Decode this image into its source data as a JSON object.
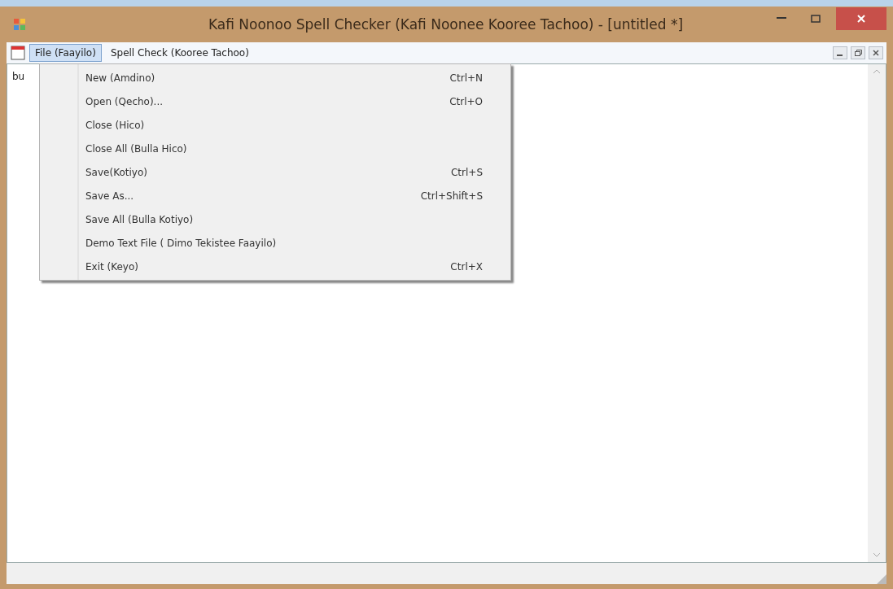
{
  "window": {
    "title": "Kafi Noonoo Spell Checker (Kafi Noonee  Kooree Tachoo)  - [untitled *]"
  },
  "menu_bar": [
    {
      "label": "File (Faayilo)",
      "selected": true
    },
    {
      "label": "Spell Check (Kooree Tachoo)",
      "selected": false
    }
  ],
  "file_menu": [
    {
      "label": "New (Amdino)",
      "shortcut": "Ctrl+N"
    },
    {
      "label": "Open (Qecho)...",
      "shortcut": "Ctrl+O"
    },
    {
      "label": "Close (Hico)"
    },
    {
      "label": "Close All (Bulla Hico)"
    },
    {
      "label": "Save(Kotiyo)",
      "shortcut": "Ctrl+S"
    },
    {
      "label": "Save As...",
      "shortcut": "Ctrl+Shift+S"
    },
    {
      "label": "Save All (Bulla Kotiyo)"
    },
    {
      "label": "Demo Text File ( Dimo Tekistee Faayilo)"
    },
    {
      "label": "Exit (Keyo)",
      "shortcut": "Ctrl+X"
    }
  ],
  "document": {
    "text": "bu"
  }
}
